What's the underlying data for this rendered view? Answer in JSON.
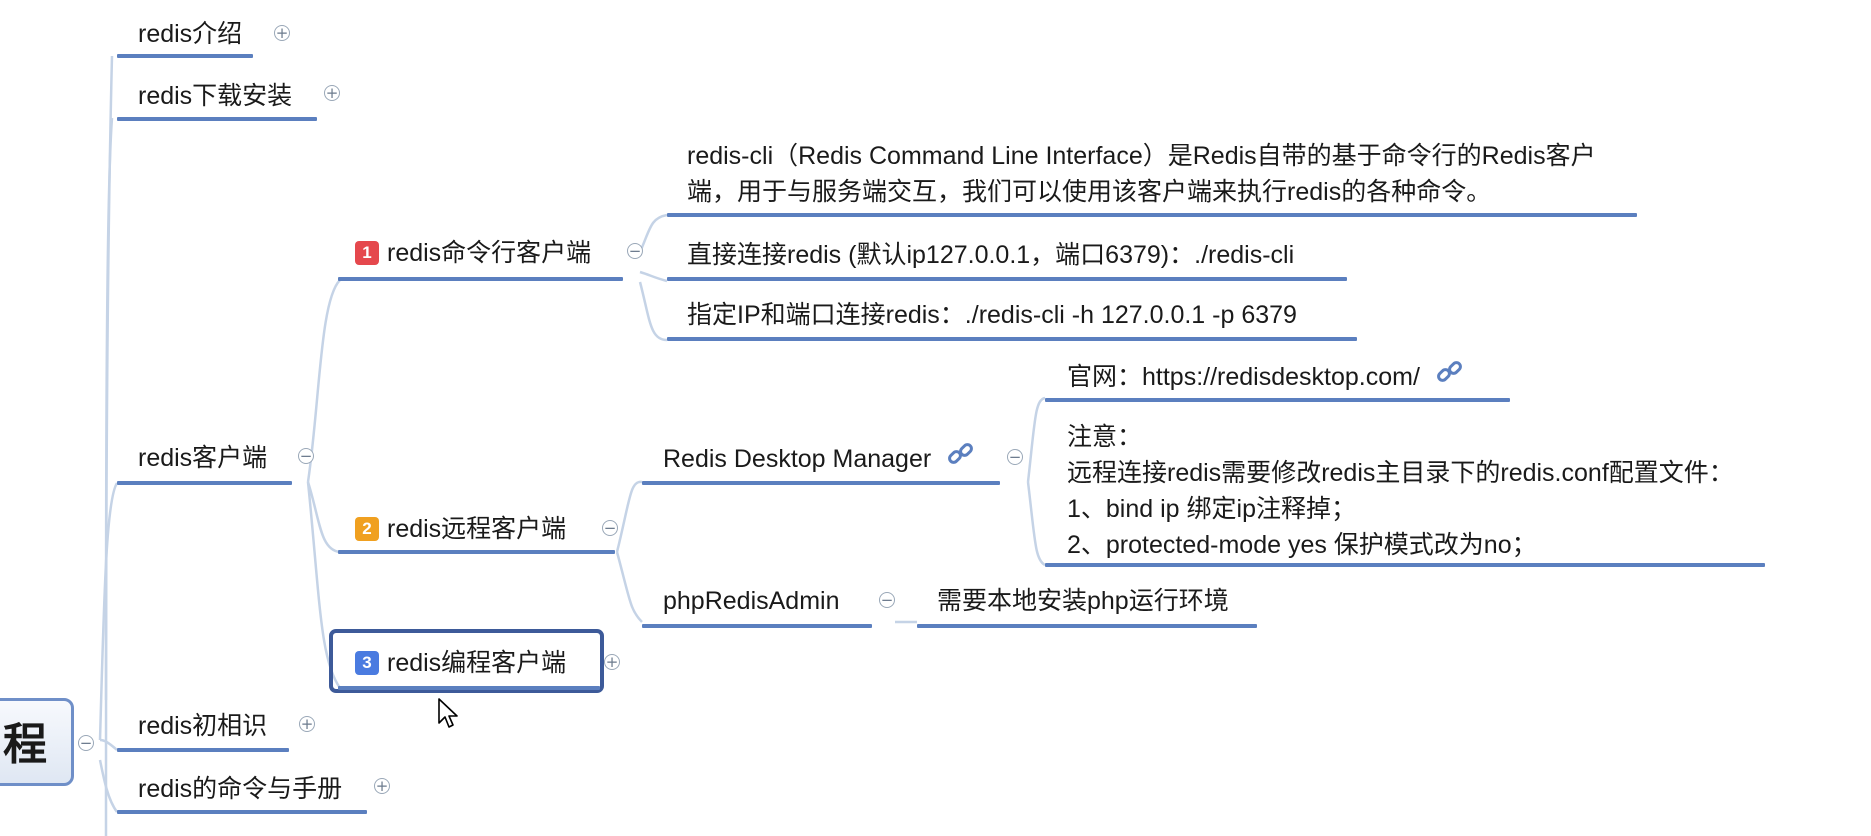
{
  "root": {
    "label": "程"
  },
  "branches": [
    {
      "label": "redis介绍",
      "toggle": "+"
    },
    {
      "label": "redis下载安装",
      "toggle": "+"
    },
    {
      "label": "redis客户端",
      "toggle": "−"
    },
    {
      "label": "redis初相识",
      "toggle": "+"
    },
    {
      "label": "redis的命令与手册",
      "toggle": "+"
    }
  ],
  "client_children": [
    {
      "badge": "1",
      "badge_color": "#e5484d",
      "label": "redis命令行客户端",
      "toggle": "−"
    },
    {
      "badge": "2",
      "badge_color": "#f0a020",
      "label": "redis远程客户端",
      "toggle": "−"
    },
    {
      "badge": "3",
      "badge_color": "#4a7be0",
      "label": "redis编程客户端",
      "toggle": "+"
    }
  ],
  "cli_notes": {
    "desc_line1": "redis-cli（Redis Command Line Interface）是Redis自带的基于命令行的Redis客户",
    "desc_line2": "端，用于与服务端交互，我们可以使用该客户端来执行redis的各种命令。",
    "direct": "直接连接redis (默认ip127.0.0.1，端口6379)：./redis-cli",
    "specify": "指定IP和端口连接redis：./redis-cli -h 127.0.0.1 -p 6379"
  },
  "remote_children": {
    "rdm": {
      "label": "Redis Desktop Manager",
      "toggle": "−",
      "icon": "link-icon"
    },
    "phpra": {
      "label": "phpRedisAdmin",
      "toggle": "−"
    }
  },
  "rdm_notes": {
    "site": "官网：https://redisdesktop.com/",
    "note_title": "注意：",
    "note_line1": "远程连接redis需要修改redis主目录下的redis.conf配置文件：",
    "note_line2": "1、bind ip 绑定ip注释掉；",
    "note_line3": "2、protected-mode yes 保护模式改为no；"
  },
  "phpra_note": "需要本地安装php运行环境",
  "colors": {
    "line": "#5b7fbf",
    "connector": "#c5d3e6",
    "selected_border": "#3d5a99"
  }
}
